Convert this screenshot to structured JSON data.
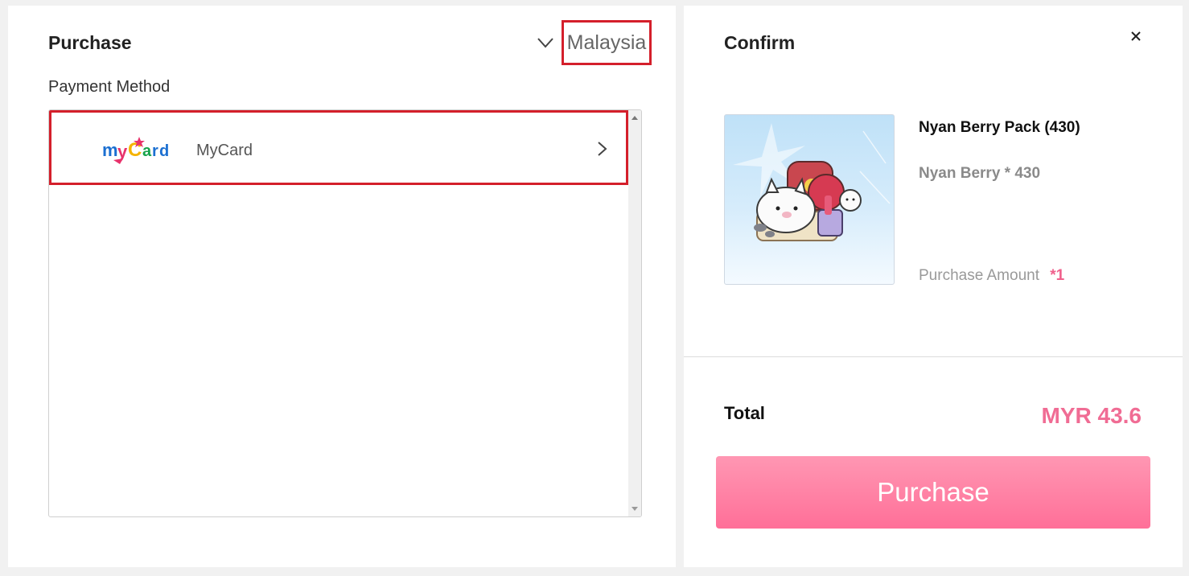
{
  "purchase_panel": {
    "title": "Purchase",
    "region": {
      "selected": "Malaysia",
      "icon": "chevron-down-icon"
    },
    "payment_method_label": "Payment Method",
    "methods": [
      {
        "label": "MyCard",
        "logo": "mycard-logo",
        "icon": "chevron-right-icon"
      }
    ]
  },
  "confirm_panel": {
    "title": "Confirm",
    "close_icon": "close-icon",
    "product": {
      "name": "Nyan Berry Pack (430)",
      "contents": "Nyan Berry * 430",
      "amount_label": "Purchase Amount",
      "amount_value": "*1"
    },
    "total_label": "Total",
    "total_value": "MYR 43.6",
    "purchase_button_label": "Purchase"
  },
  "colors": {
    "highlight_border": "#d41f2b",
    "accent_pink": "#f06c94",
    "button_gradient_top": "#ff97b3",
    "button_gradient_bottom": "#ff6f98"
  }
}
